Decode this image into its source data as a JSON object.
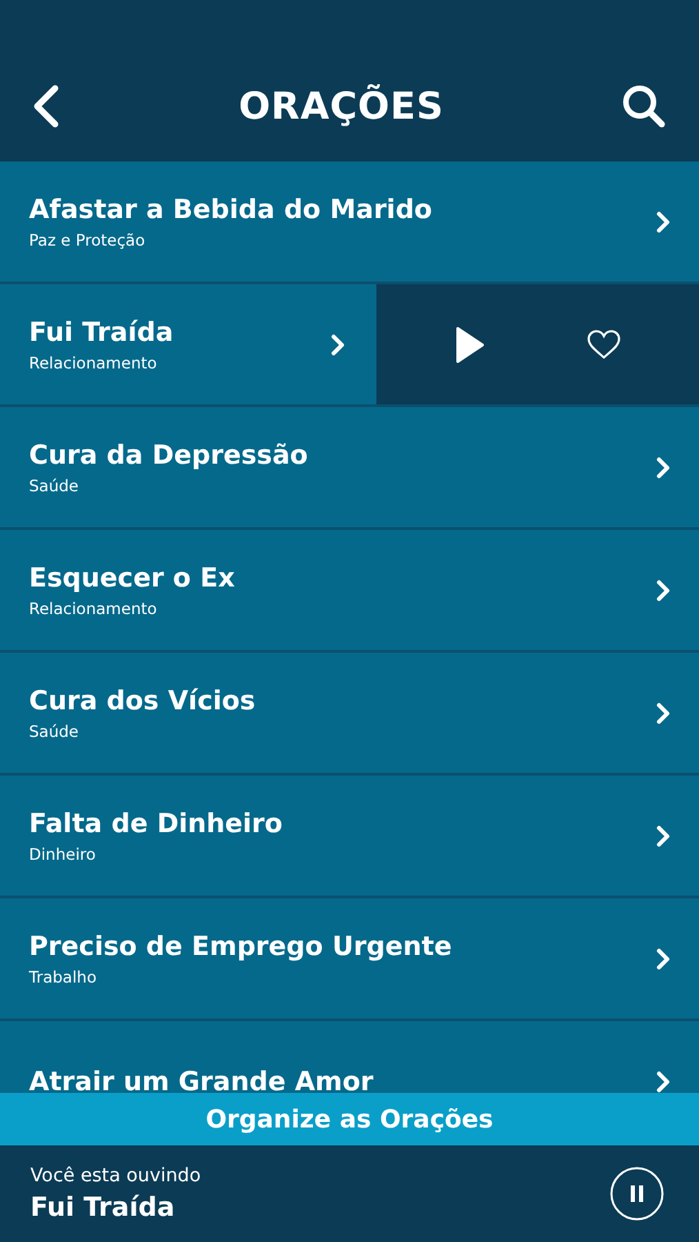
{
  "header": {
    "title": "ORAÇÕES"
  },
  "prayers": [
    {
      "title": "Afastar a Bebida do Marido",
      "category": "Paz e Proteção",
      "swiped": false
    },
    {
      "title": "Fui Traída",
      "category": "Relacionamento",
      "swiped": true
    },
    {
      "title": "Cura da Depressão",
      "category": "Saúde",
      "swiped": false
    },
    {
      "title": "Esquecer o Ex",
      "category": "Relacionamento",
      "swiped": false
    },
    {
      "title": "Cura dos Vícios",
      "category": "Saúde",
      "swiped": false
    },
    {
      "title": "Falta de Dinheiro",
      "category": "Dinheiro",
      "swiped": false
    },
    {
      "title": "Preciso de Emprego Urgente",
      "category": "Trabalho",
      "swiped": false
    },
    {
      "title": "Atrair um Grande Amor",
      "swiped": false
    }
  ],
  "organize_button": "Organize as Orações",
  "player": {
    "label": "Você esta ouvindo",
    "track": "Fui Traída",
    "playing": true
  }
}
